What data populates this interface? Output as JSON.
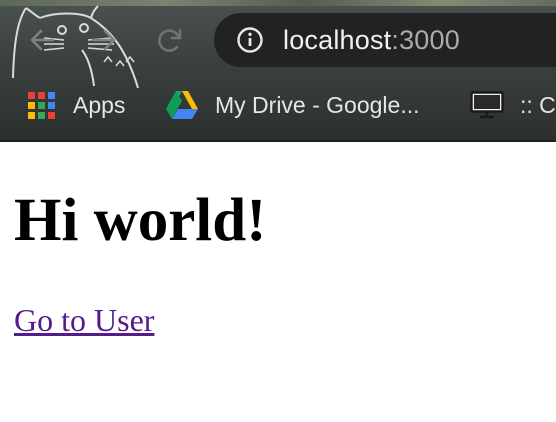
{
  "browser": {
    "address_bar": {
      "host": "localhost",
      "port": ":3000",
      "site_info_icon": "info-icon"
    },
    "nav": {
      "back_icon": "back-arrow-icon",
      "forward_icon": "forward-arrow-icon",
      "reload_icon": "reload-icon"
    },
    "bookmarks": [
      {
        "label": "Apps",
        "icon": "apps-grid-icon"
      },
      {
        "label": "My Drive - Google...",
        "icon": "google-drive-icon"
      },
      {
        "label": ":: C",
        "icon": "monitor-icon"
      }
    ],
    "colors": {
      "toolbar": "#3a403e",
      "omnibox": "#202322",
      "visited_link": "#551a8b"
    }
  },
  "page": {
    "heading": "Hi world!",
    "link_label": "Go to User"
  }
}
